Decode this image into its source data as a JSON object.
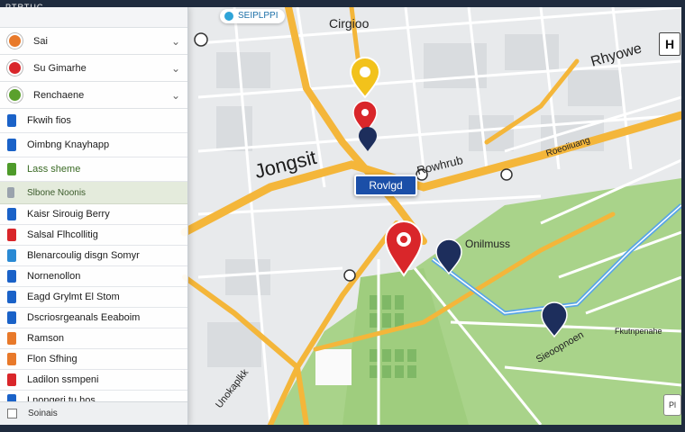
{
  "window": {
    "title": "PTRTUG"
  },
  "sidebar": {
    "accordions": [
      {
        "label": "Sai",
        "color": "#e8792a"
      },
      {
        "label": "Su Gimarhe",
        "color": "#d9262a"
      },
      {
        "label": "Renchaene",
        "color": "#5aa02c"
      }
    ],
    "top_items": [
      {
        "label": "Fkwih fios",
        "color": "#1a62c8"
      },
      {
        "label": "Oimbng Knayhapp",
        "color": "#1a62c8"
      },
      {
        "label": "Lass sheme",
        "color": "#4e9a2a"
      }
    ],
    "section_header": "Slbone Noonis",
    "items": [
      {
        "label": "Kaisr Sirouig Berry",
        "color": "#1a62c8"
      },
      {
        "label": "Salsal Flhcollitig",
        "color": "#d9262a"
      },
      {
        "label": "Blenarcoulig disgn Somyr",
        "color": "#2a8ad4"
      },
      {
        "label": "Nornenollon",
        "color": "#1a62c8"
      },
      {
        "label": "Eagd Grylmt El Stom",
        "color": "#1a62c8"
      },
      {
        "label": "Dscriosrgeanals Eeaboim",
        "color": "#1a62c8"
      },
      {
        "label": "Ramson",
        "color": "#e8792a"
      },
      {
        "label": "Flon Sfhing",
        "color": "#e8792a"
      },
      {
        "label": "Ladilon ssmpeni",
        "color": "#d9262a"
      },
      {
        "label": "Lnongeri tu hos",
        "color": "#1a62c8"
      }
    ],
    "footer_label": "Soinais"
  },
  "map": {
    "route_label": "Rovlgd",
    "district_label": "Jongsit",
    "legend_chip": "SEIPLPPI",
    "labels": {
      "north": "Cirgioo",
      "center": "Rowhrub",
      "east": "Onilmuss",
      "top_right": "Rhyowe",
      "road_ne": "Roeoiiuang",
      "diag_south": "Sieoopnoen",
      "park": "Fkutnpenahe",
      "bottom_diag": "Unokaplkk"
    },
    "corner_button": "H",
    "scale_button": "Pl"
  },
  "colors": {
    "highway": "#f4b63a",
    "park": "#a9d38a",
    "water": "#5aa6e6",
    "pin_red": "#d9262a",
    "pin_navy": "#1d2e5c",
    "pin_yellow": "#f2c21b"
  }
}
